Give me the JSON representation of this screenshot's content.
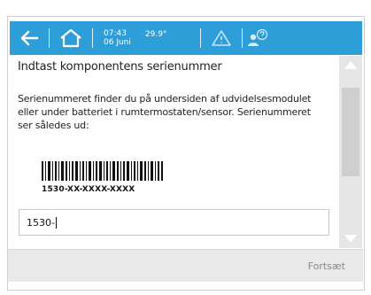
{
  "status_bar": {
    "time": "07:43",
    "date": "06 Juni",
    "temperature": "29.9°"
  },
  "screen": {
    "title": "Indtast komponentens serienummer",
    "description": "Serienummeret finder du på undersiden af udvidelsesmodulet eller under batteriet i rumtermostaten/sensor. Serienummeret ser således ud:",
    "barcode_label": "1530-XX-XXXX-XXXX",
    "serial_input_value": "1530-"
  },
  "footer": {
    "continue_label": "Fortsæt"
  },
  "colors": {
    "topbar": "#2e9ed8",
    "scrollbar": "#e6e6e6",
    "footer": "#e9e9e9"
  }
}
